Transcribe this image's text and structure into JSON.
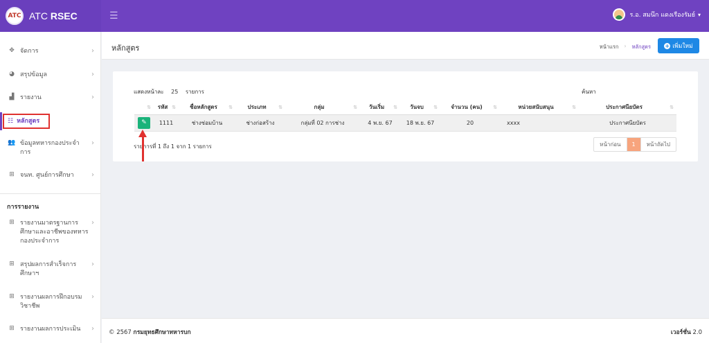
{
  "brand": {
    "logo_text": "ATC",
    "name_prefix": "ATC ",
    "name_bold": "RSEC"
  },
  "topbar": {
    "user_name": "ร.อ. สมนึก แดงเรืองรัมย์"
  },
  "sidebar": {
    "items": [
      {
        "label": "จัดการ",
        "icon": "arrows-move-icon"
      },
      {
        "label": "สรุปข้อมูล",
        "icon": "pie-chart-icon"
      },
      {
        "label": "รายงาน",
        "icon": "bar-chart-icon"
      },
      {
        "label": "หลักสูตร",
        "icon": "list-icon"
      },
      {
        "label": "ข้อมูลทหารกองประจำการ",
        "icon": "users-icon"
      },
      {
        "label": "จนท. ศูนย์การศึกษา",
        "icon": "grid-icon"
      }
    ],
    "section_title": "การรายงาน",
    "report_items": [
      {
        "label": "รายงานมาตรฐานการศึกษาและอาชีพของทหารกองประจำการ",
        "icon": "grid-icon"
      },
      {
        "label": "สรุปผลการสำเร็จการศึกษาฯ",
        "icon": "grid-icon"
      },
      {
        "label": "รายงานผลการฝึกอบรมวิชาชีพ",
        "icon": "grid-icon"
      },
      {
        "label": "รายงานผลการประเมิน",
        "icon": "grid-icon"
      }
    ]
  },
  "header": {
    "page_title": "หลักสูตร",
    "breadcrumb": [
      "หน้าแรก",
      "หลักสูตร"
    ],
    "add_button": "เพิ่มใหม่"
  },
  "table": {
    "length_label": "แสดงหน้าละ",
    "length_value": "25",
    "length_suffix": "รายการ",
    "search_label": "ค้นหา",
    "columns": [
      "",
      "รหัส",
      "ชื่อหลักสูตร",
      "ประเภท",
      "กลุ่ม",
      "วันเริ่ม",
      "วันจบ",
      "จำนวน (คน)",
      "หน่วยสนับสนุน",
      "ประกาศนียบัตร"
    ],
    "rows": [
      [
        "",
        "1111",
        "ช่างซ่อมบ้าน",
        "ช่างก่อสร้าง",
        "กลุ่มที่ 02 การช่าง",
        "4 พ.ย. 67",
        "18 พ.ย. 67",
        "20",
        "xxxx",
        "ประกาศนียบัตร"
      ]
    ],
    "info": "รายการที่ 1 ถึง 1 จาก 1 รายการ",
    "pagination": {
      "prev": "หน้าก่อน",
      "current": "1",
      "next": "หน้าถัดไป"
    }
  },
  "footer": {
    "copyright_prefix": "© 2567 ",
    "copyright_org": "กรมยุทธศึกษาทหารบก",
    "version_label": "เวอร์ชั่น",
    "version_value": "2.0"
  },
  "colors": {
    "brand": "#6f42c1",
    "accent_button": "#1e88e5",
    "edit_button": "#1ab37a",
    "highlight": "#e0312f"
  }
}
